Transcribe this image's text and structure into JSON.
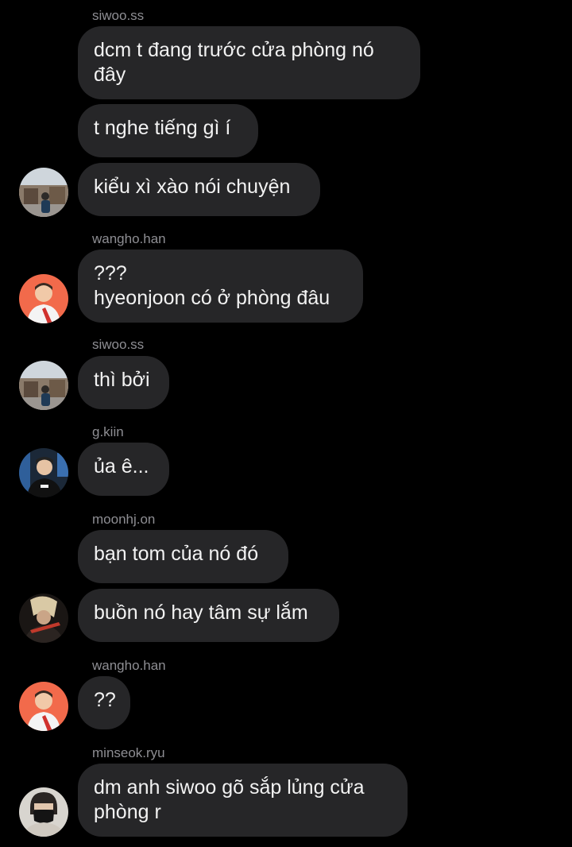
{
  "thread": {
    "messages": [
      {
        "sender": "siwoo.ss",
        "text": "dcm t đang trước cửa phòng nó\nđây"
      },
      {
        "sender": "",
        "text": "t nghe tiếng gì í"
      },
      {
        "sender": "",
        "text": "kiểu xì xào nói chuyện",
        "avatar": "siwoo-avatar"
      },
      {
        "sender": "wangho.han",
        "text": "???\nhyeonjoon có ở phòng đâu",
        "avatar": "wangho-avatar"
      },
      {
        "sender": "siwoo.ss",
        "text": "thì bởi",
        "avatar": "siwoo-avatar"
      },
      {
        "sender": "g.kiin",
        "text": "ủa ê...",
        "avatar": "gkiin-avatar"
      },
      {
        "sender": "moonhj.on",
        "text": "bạn tom của nó đó"
      },
      {
        "sender": "",
        "text": "buồn nó hay tâm sự lắm",
        "avatar": "moonhj-avatar"
      },
      {
        "sender": "wangho.han",
        "text": "??",
        "avatar": "wangho-avatar"
      },
      {
        "sender": "minseok.ryu",
        "text": "dm anh siwoo gõ sắp lủng cửa\nphòng r",
        "avatar": "minseok-avatar"
      }
    ]
  },
  "colors": {
    "background": "#000000",
    "bubble": "#262628",
    "text": "#f2f2f2",
    "sender": "#8e8e93"
  }
}
